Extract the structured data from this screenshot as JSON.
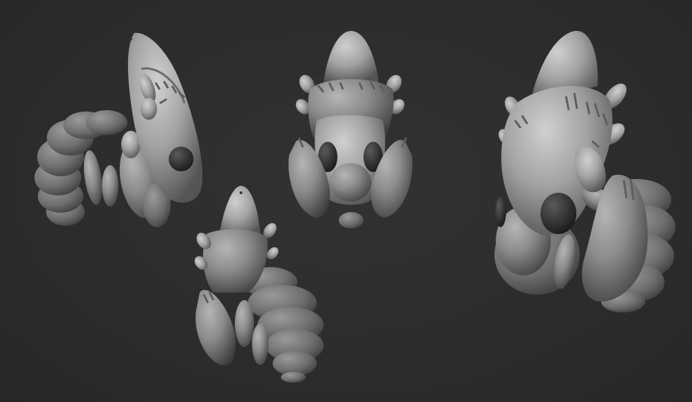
{
  "scene": {
    "background_color": "#2c2c2c",
    "clay_color": "#8a8a8a",
    "eye_color": "#2a2a2a",
    "models": [
      {
        "id": "model-side-view",
        "view": "side"
      },
      {
        "id": "model-front-view",
        "view": "front"
      },
      {
        "id": "model-back-view",
        "view": "back"
      },
      {
        "id": "model-three-quarter-view",
        "view": "three-quarter"
      }
    ]
  }
}
